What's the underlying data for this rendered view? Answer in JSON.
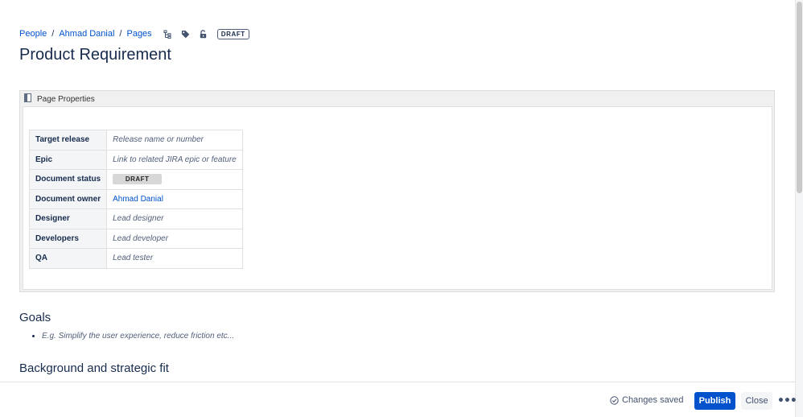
{
  "breadcrumb": {
    "items": [
      "People",
      "Ahmad Danial",
      "Pages"
    ],
    "separator": "/",
    "icons": [
      "page-tree-icon",
      "label-icon",
      "restrictions-icon"
    ],
    "status": "DRAFT"
  },
  "page": {
    "title": "Product Requirement"
  },
  "properties": {
    "macro_title": "Page Properties",
    "macro_icon": "page-properties-icon",
    "rows": [
      {
        "key": "Target release",
        "value": "Release name or number"
      },
      {
        "key": "Epic",
        "value": "Link to related JIRA epic or feature"
      },
      {
        "key": "Document status",
        "value": "DRAFT"
      },
      {
        "key": "Document owner",
        "value": "Ahmad Danial"
      },
      {
        "key": "Designer",
        "value": "Lead designer"
      },
      {
        "key": "Developers",
        "value": "Lead developer"
      },
      {
        "key": "QA",
        "value": "Lead tester"
      }
    ]
  },
  "goals": {
    "heading": "Goals",
    "items": [
      "E.g. Simplify the user experience, reduce friction etc..."
    ]
  },
  "background": {
    "heading": "Background and strategic fit"
  },
  "footer": {
    "saved_text": "Changes saved",
    "saved_icon": "check-circle-icon",
    "publish_label": "Publish",
    "close_label": "Close",
    "more_label": "•••"
  },
  "colors": {
    "link": "#0052cc",
    "primary_button": "#0052cc",
    "text": "#172b4d",
    "placeholder": "#505f79"
  }
}
